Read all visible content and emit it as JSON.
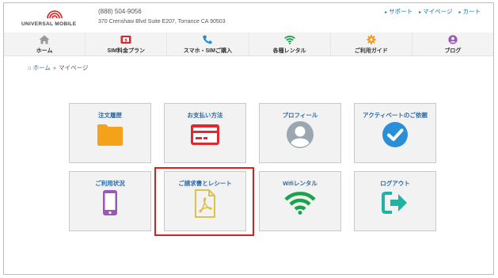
{
  "header": {
    "brand": "UNIVERSAL MOBILE",
    "phone": "(888) 504-9056",
    "address": "370 Crenshaw Blvd Suite E207, Torrance CA 90503",
    "links": [
      "サポート",
      "マイページ",
      "カート"
    ]
  },
  "nav": [
    {
      "label": "ホーム",
      "icon": "home-icon",
      "color": "#9a9a9a"
    },
    {
      "label": "SIM料金プラン",
      "icon": "sim-plan-icon",
      "color": "#d9272e"
    },
    {
      "label": "スマホ・SIMご購入",
      "icon": "phone-icon",
      "color": "#1f8fd3"
    },
    {
      "label": "各種レンタル",
      "icon": "wifi-icon",
      "color": "#18a04a"
    },
    {
      "label": "ご利用ガイド",
      "icon": "gear-icon",
      "color": "#f39a1e"
    },
    {
      "label": "ブログ",
      "icon": "user-icon",
      "color": "#9b59b6"
    }
  ],
  "breadcrumb": {
    "home": "ホーム",
    "separator": "»",
    "current": "マイページ"
  },
  "tiles": [
    {
      "label": "注文履歴",
      "icon": "folder-icon",
      "color": "#f5a21b"
    },
    {
      "label": "お支払い方法",
      "icon": "credit-card-icon",
      "color": "#e0282f"
    },
    {
      "label": "プロフィール",
      "icon": "profile-icon",
      "color": "#9aa7ae"
    },
    {
      "label": "アクティベートのご依頼",
      "icon": "check-circle-icon",
      "color": "#2a8fd6"
    },
    {
      "label": "ご利用状況",
      "icon": "mobile-phone-icon",
      "color": "#9b59b6"
    },
    {
      "label": "ご請求書とレシート",
      "icon": "pdf-document-icon",
      "color": "#dcc24a"
    },
    {
      "label": "Wifiレンタル",
      "icon": "wifi-icon",
      "color": "#1aa34a"
    },
    {
      "label": "ログアウト",
      "icon": "logout-icon",
      "color": "#1fb3a6"
    }
  ],
  "colors": {
    "link": "#1a6fb3",
    "highlight": "#e31b1b",
    "logo_red": "#e31b1b"
  }
}
